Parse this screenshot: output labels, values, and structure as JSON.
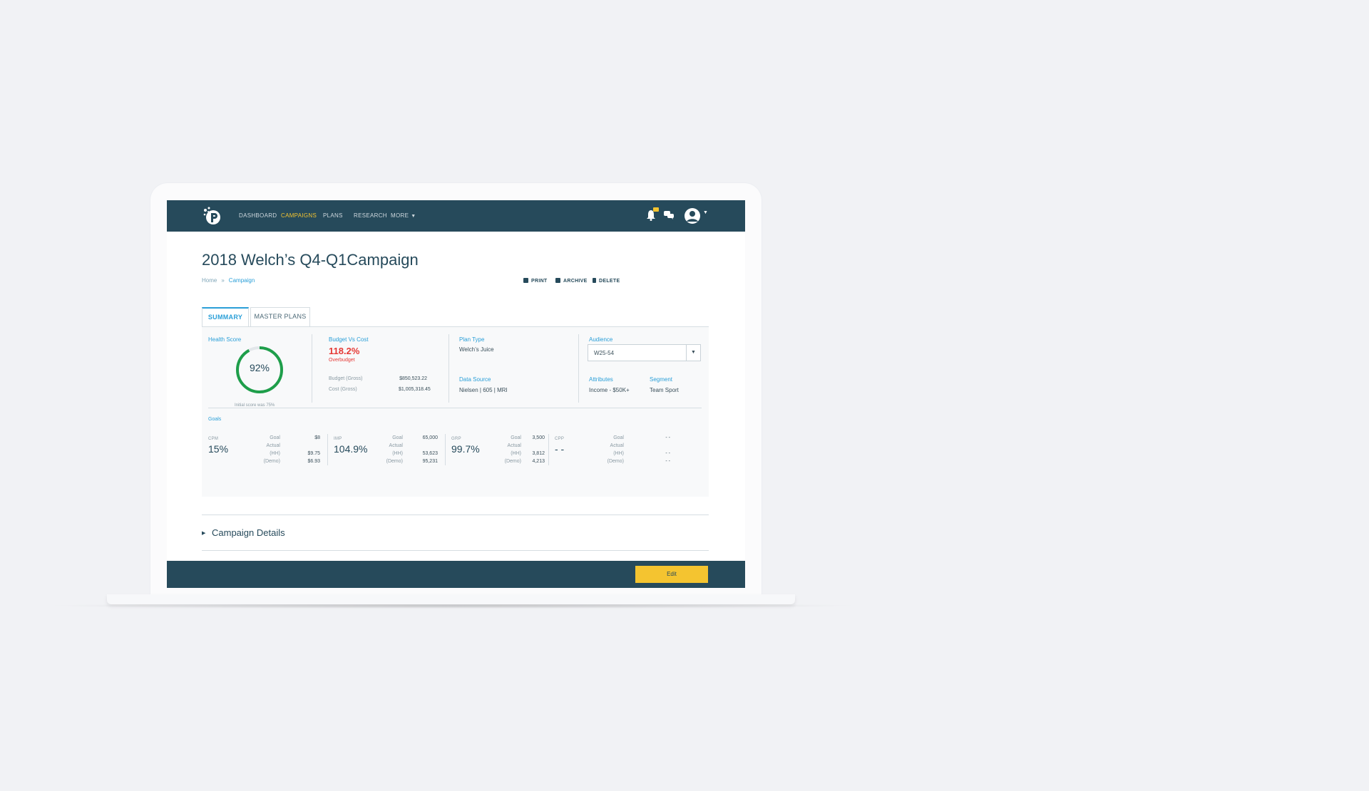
{
  "nav": {
    "items": [
      "DASHBOARD",
      "CAMPAIGNS",
      "PLANS",
      "RESEARCH",
      "MORE"
    ],
    "active": "CAMPAIGNS"
  },
  "page": {
    "title": "2018 Welch’s Q4-Q1Campaign",
    "breadcrumb": [
      "Home",
      "Campaign"
    ],
    "actions": [
      "PRINT",
      "ARCHIVE",
      "DELETE"
    ]
  },
  "tabs": [
    "SUMMARY",
    "MASTER PLANS"
  ],
  "summary": {
    "health": {
      "label": "Health Score",
      "score": "92%",
      "score_value": 0.92,
      "note": "Initial score was 75%"
    },
    "budget": {
      "label": "Budget Vs Cost",
      "pct": "118.2%",
      "status": "Overbudget",
      "rows": [
        {
          "k": "Budget (Gross)",
          "v": "$850,523.22"
        },
        {
          "k": "Cost (Gross)",
          "v": "$1,005,318.45"
        }
      ]
    },
    "plan_type": {
      "label": "Plan Type",
      "value": "Welch’s Juice"
    },
    "data_source": {
      "label": "Data Source",
      "value": "Nielsen | 605 | MRI"
    },
    "audience": {
      "label": "Audience",
      "value": "W25-54"
    },
    "attributes": {
      "label": "Attributes",
      "value": "Income - $50K+"
    },
    "segment": {
      "label": "Segment",
      "value": "Team Sport"
    }
  },
  "goals": {
    "label": "Goals",
    "items": [
      {
        "name": "CPM",
        "pct": "15%",
        "goal": "$8",
        "actual_hh": "$9.75",
        "actual_demo": "$6.93"
      },
      {
        "name": "IMP",
        "pct": "104.9%",
        "goal": "65,000",
        "actual_hh": "53,623",
        "actual_demo": "95,231"
      },
      {
        "name": "GRP",
        "pct": "99.7%",
        "goal": "3,500",
        "actual_hh": "3,812",
        "actual_demo": "4,213"
      },
      {
        "name": "CPP",
        "pct": "- -",
        "goal": "- -",
        "actual_hh": "- -",
        "actual_demo": "- -"
      }
    ],
    "keys": {
      "goal": "Goal",
      "actual": "Actual",
      "hh": "(HH)",
      "demo": "(Demo)"
    }
  },
  "details": {
    "title": "Campaign Details"
  },
  "footer": {
    "edit_label": "Edit"
  },
  "colors": {
    "navy": "#264a5b",
    "accent_yellow": "#f4c430",
    "link_blue": "#2a9fd8",
    "alert_red": "#e53935",
    "gauge_green": "#1e9e4a"
  }
}
